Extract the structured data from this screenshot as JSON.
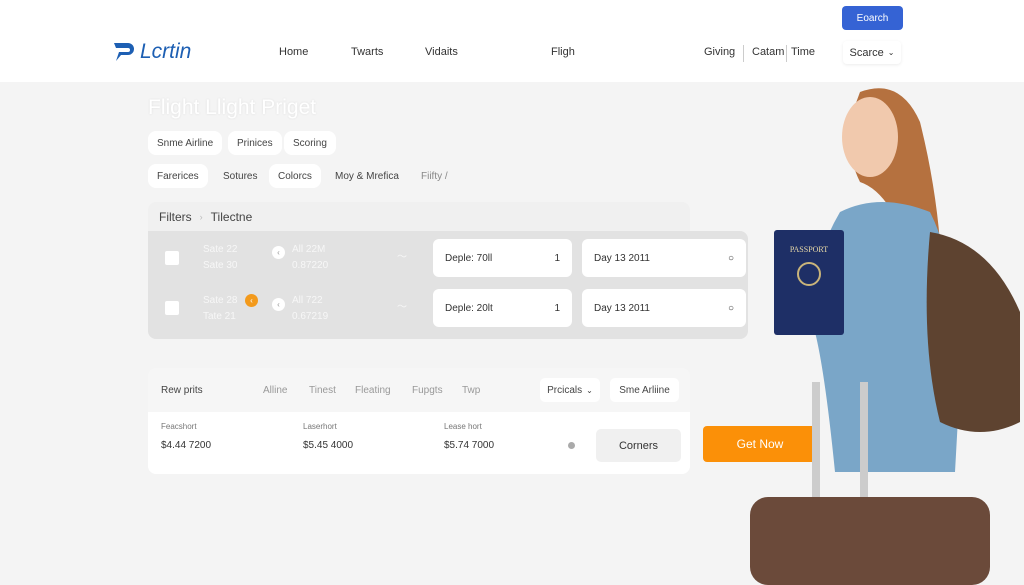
{
  "header": {
    "logo": "Lcrtin",
    "nav": [
      "Home",
      "Twarts",
      "Vidaits",
      "Fligh"
    ],
    "links": [
      "Giving",
      "Catam",
      "Time"
    ],
    "search_button": "Eoarch",
    "select": "Scarce"
  },
  "hero": {
    "title": "Flight Llight Priget",
    "chips_row1": [
      "Snme Airline",
      "Prinices",
      "Scoring"
    ],
    "chips_row2": [
      "Farerices",
      "Sotures",
      "Colorcs",
      "Moy & Mrefica",
      "Fiifty /"
    ]
  },
  "filters": {
    "breadcrumb": [
      "Filters",
      "Tilectne"
    ]
  },
  "rows": [
    {
      "a": "Sate 22",
      "b": "Sate 30",
      "c": "All 22M",
      "d": "0.87220",
      "depart": "Deple: 70ll",
      "qty": "1",
      "date": "Day 13 2011"
    },
    {
      "a": "Sate 28",
      "b": "Tate 21",
      "c": "All 722",
      "d": "0.67219",
      "depart": "Deple: 20lt",
      "qty": "1",
      "date": "Day 13 2011"
    }
  ],
  "results": {
    "title": "Rew prits",
    "tabs": [
      "Alline",
      "Tinest",
      "Fleating",
      "Fupgts",
      "Twp"
    ],
    "dropdown": "Prcicals",
    "button": "Sme Arliine",
    "cols": [
      {
        "label": "Feacshort",
        "value": "$4.44 7200"
      },
      {
        "label": "Laserhort",
        "value": "$5.45 4000"
      },
      {
        "label": "Lease hort",
        "value": "$5.74 7000"
      }
    ],
    "corners": "Corners"
  },
  "cta": {
    "label": "Get Now",
    "color": "#fb9008"
  },
  "photo": {
    "passport_text": "PASSPORT"
  },
  "colors": {
    "accent": "#3563d4",
    "logo": "#1d5fb3"
  }
}
